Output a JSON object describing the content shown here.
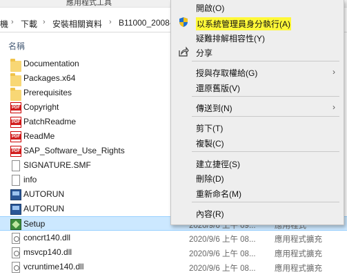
{
  "ribbon": {
    "tab_left": "",
    "tab_app_tools": "應用程式工具"
  },
  "address": {
    "segments": [
      "機",
      "下載",
      "安裝相關資料",
      "B11000_2008-"
    ]
  },
  "list": {
    "name_header": "名稱",
    "rows": [
      {
        "icon": "folder-icon",
        "name": "Documentation",
        "date": "",
        "type": ""
      },
      {
        "icon": "folder-icon",
        "name": "Packages.x64",
        "date": "",
        "type": ""
      },
      {
        "icon": "folder-icon",
        "name": "Prerequisites",
        "date": "",
        "type": ""
      },
      {
        "icon": "pdf-icon",
        "name": "Copyright",
        "date": "",
        "type": ""
      },
      {
        "icon": "pdf-icon",
        "name": "PatchReadme",
        "date": "",
        "type": ""
      },
      {
        "icon": "pdf-icon",
        "name": "ReadMe",
        "date": "",
        "type": ""
      },
      {
        "icon": "pdf-icon",
        "name": "SAP_Software_Use_Rights",
        "date": "",
        "type": ""
      },
      {
        "icon": "file-icon",
        "name": "SIGNATURE.SMF",
        "date": "",
        "type": ""
      },
      {
        "icon": "file-icon",
        "name": "info",
        "date": "",
        "type": ""
      },
      {
        "icon": "app-icon",
        "name": "AUTORUN",
        "date": "",
        "type": ""
      },
      {
        "icon": "app-icon",
        "name": "AUTORUN",
        "date": "",
        "type": ""
      },
      {
        "icon": "setup-icon",
        "name": "Setup",
        "date": "2020/9/6 上午 09...",
        "type": "應用程式"
      },
      {
        "icon": "dll-icon",
        "name": "concrt140.dll",
        "date": "2020/9/6 上午 08...",
        "type": "應用程式擴充"
      },
      {
        "icon": "dll-icon",
        "name": "msvcp140.dll",
        "date": "2020/9/6 上午 08...",
        "type": "應用程式擴充"
      },
      {
        "icon": "dll-icon",
        "name": "vcruntime140.dll",
        "date": "2020/9/6 上午 08...",
        "type": "應用程式擴充"
      }
    ]
  },
  "context_menu": {
    "open": "開啟(O)",
    "run_as_admin": "以系統管理員身分執行(A)",
    "troubleshoot": "疑難排解相容性(Y)",
    "share": "分享",
    "give_access": "授與存取權給(G)",
    "restore": "還原舊版(V)",
    "send_to": "傳送到(N)",
    "cut": "剪下(T)",
    "copy": "複製(C)",
    "create_shortcut": "建立捷徑(S)",
    "delete": "刪除(D)",
    "rename": "重新命名(M)",
    "properties": "內容(R)",
    "highlight_color": "#fff838"
  }
}
